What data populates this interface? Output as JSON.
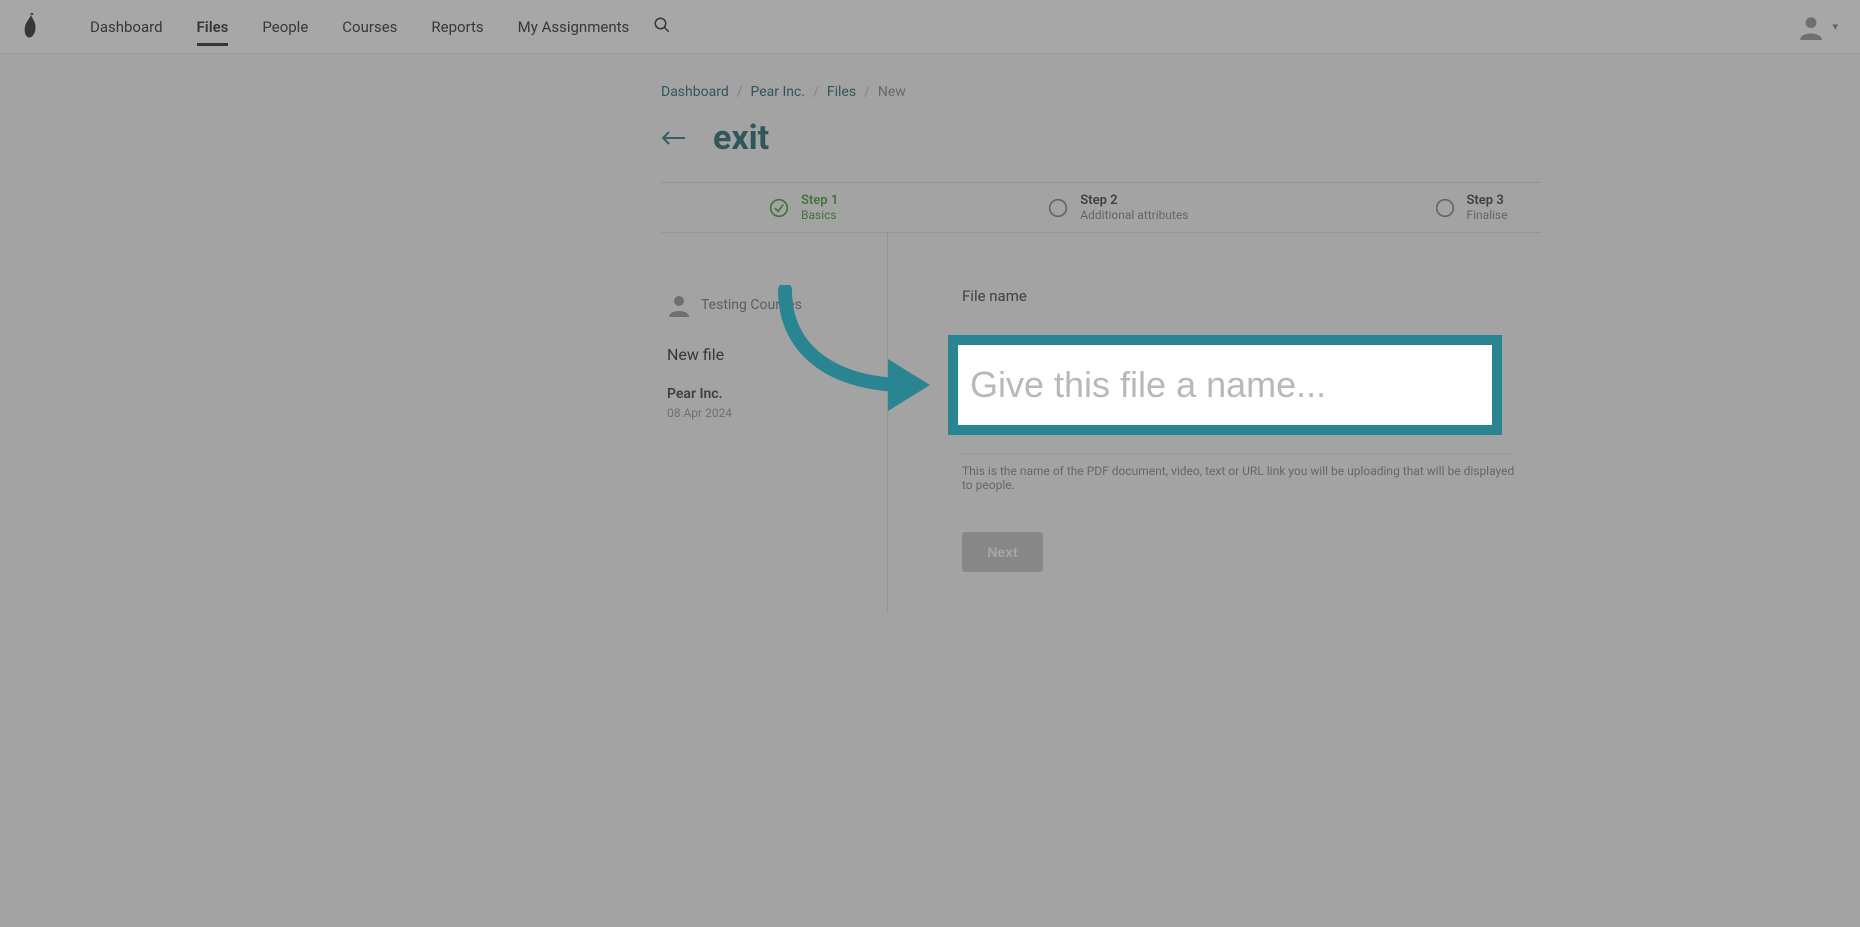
{
  "nav": {
    "items": [
      {
        "label": "Dashboard",
        "active": false
      },
      {
        "label": "Files",
        "active": true
      },
      {
        "label": "People",
        "active": false
      },
      {
        "label": "Courses",
        "active": false
      },
      {
        "label": "Reports",
        "active": false
      },
      {
        "label": "My Assignments",
        "active": false
      }
    ]
  },
  "breadcrumb": {
    "items": [
      "Dashboard",
      "Pear Inc.",
      "Files"
    ],
    "current": "New"
  },
  "page": {
    "title": "exit"
  },
  "stepper": {
    "steps": [
      {
        "title": "Step 1",
        "sub": "Basics",
        "active": true
      },
      {
        "title": "Step 2",
        "sub": "Additional attributes",
        "active": false
      },
      {
        "title": "Step 3",
        "sub": "Finalise",
        "active": false
      }
    ]
  },
  "leftPane": {
    "author": "Testing Courses",
    "file_title": "New file",
    "company": "Pear Inc.",
    "date": "08 Apr 2024"
  },
  "form": {
    "file_name_label": "File name",
    "file_name_placeholder": "Give this file a name...",
    "file_name_value": "",
    "helper": "This is the name of the PDF document, video, text or URL link you will be uploading that will be displayed to people.",
    "next_label": "Next"
  }
}
